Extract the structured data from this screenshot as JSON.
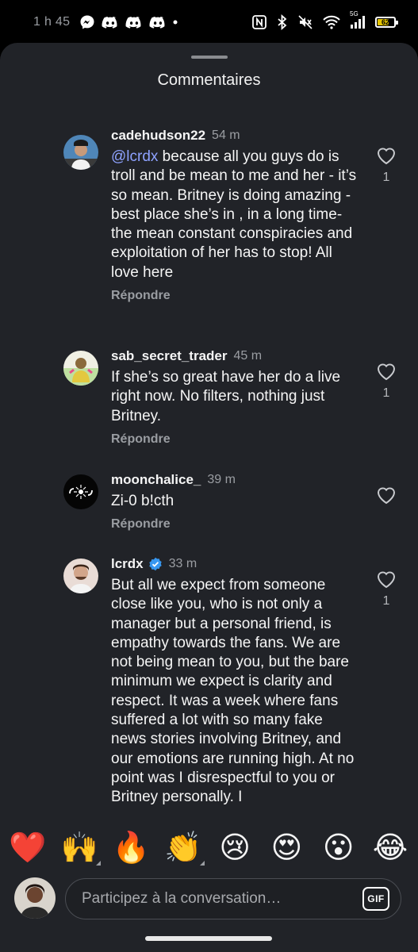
{
  "status_bar": {
    "time": "1 h 45",
    "left_icons": [
      "messenger-icon",
      "discord-icon",
      "discord-icon",
      "discord-icon",
      "dot-icon"
    ],
    "right_icons": [
      "nfc-icon",
      "bluetooth-icon",
      "mute-icon",
      "wifi-icon",
      "signal-5g-icon",
      "battery-icon"
    ],
    "network": "5G",
    "battery_percent": "62",
    "battery_level": 0.62,
    "battery_color": "#e4c400"
  },
  "sheet": {
    "title": "Commentaires"
  },
  "comments": [
    {
      "username": "cadehudson22",
      "time": "54 m",
      "verified": false,
      "mention": "@lcrdx",
      "text": " because all you guys do is troll and be mean to me and her - it’s so mean. Britney is doing amazing - best place she’s in , in a long time- the mean constant conspiracies and exploitation of her has to stop! All love here",
      "reply_label": "Répondre",
      "like_count": "1"
    },
    {
      "username": "sab_secret_trader",
      "time": "45 m",
      "verified": false,
      "mention": "",
      "text": "If she’s so great have her do a live right now. No filters, nothing just Britney.",
      "reply_label": "Répondre",
      "like_count": "1"
    },
    {
      "username": "moonchalice_",
      "time": "39 m",
      "verified": false,
      "mention": "",
      "text": "Zi-0 b!cth",
      "reply_label": "Répondre",
      "like_count": ""
    },
    {
      "username": "lcrdx",
      "time": "33 m",
      "verified": true,
      "mention": "",
      "text": "But all we expect from someone close like you, who is not only a manager but a personal friend, is empathy towards the fans. We are not being mean to you, but the bare minimum we expect is clarity and respect. It was a week where fans suffered a lot with so many fake news stories involving Britney, and our emotions are running high. At no point was I disrespectful to you or Britney personally. I",
      "reply_label": "",
      "like_count": "1"
    }
  ],
  "emoji_bar": [
    "❤️",
    "🙌",
    "🔥",
    "👏",
    "😢",
    "😍",
    "😮",
    "😂"
  ],
  "composer": {
    "placeholder": "Participez à la conversation…",
    "gif_label": "GIF"
  },
  "colors": {
    "sheet_background": "#212328",
    "mention": "#8ea2ff",
    "verified_badge": "#3797f0",
    "heart_emoji": "#e8213b"
  }
}
